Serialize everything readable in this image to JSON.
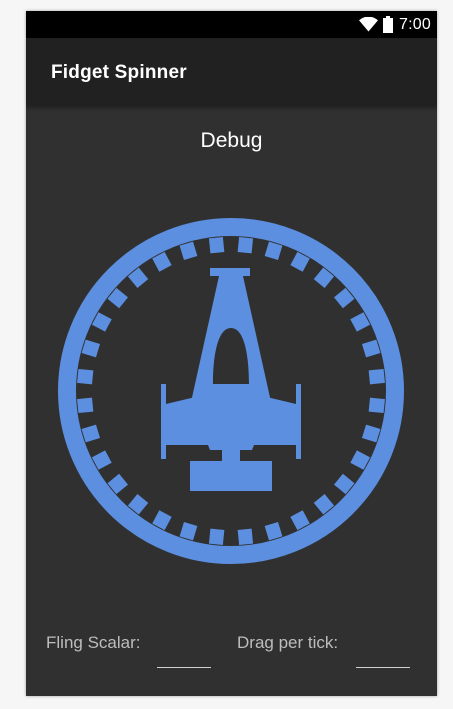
{
  "status_bar": {
    "time": "7:00",
    "icons": [
      "wifi-icon",
      "battery-icon"
    ]
  },
  "app_bar": {
    "title": "Fidget Spinner"
  },
  "main": {
    "debug_label": "Debug",
    "spinner": {
      "icon": "starfighter-spinner-icon",
      "color": "#5c8fe0"
    }
  },
  "footer": {
    "fling_scalar_label": "Fling Scalar:",
    "fling_scalar_value": "",
    "drag_per_tick_label": "Drag per tick:",
    "drag_per_tick_value": ""
  },
  "colors": {
    "background": "#303030",
    "app_bar": "#212121",
    "status_bar": "#000000",
    "accent": "#5c8fe0"
  }
}
